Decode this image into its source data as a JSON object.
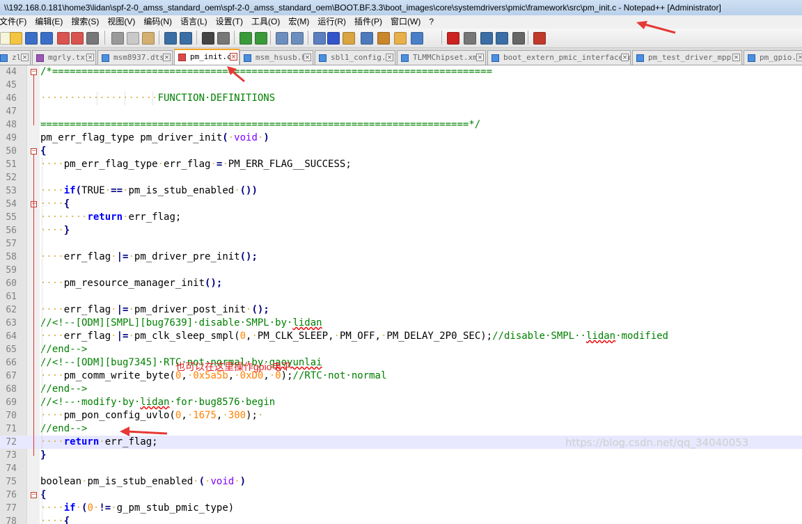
{
  "window": {
    "title": "\\\\192.168.0.181\\home3\\lidan\\spf-2-0_amss_standard_oem\\spf-2-0_amss_standard_oem\\BOOT.BF.3.3\\boot_images\\core\\systemdrivers\\pmic\\framework\\src\\pm_init.c - Notepad++ [Administrator]"
  },
  "menu": [
    "文件(F)",
    "编辑(E)",
    "搜索(S)",
    "视图(V)",
    "编码(N)",
    "语言(L)",
    "设置(T)",
    "工具(O)",
    "宏(M)",
    "运行(R)",
    "插件(P)",
    "窗口(W)",
    "?"
  ],
  "toolbar": {
    "icons": [
      "new-file-icon",
      "open-file-icon",
      "save-icon",
      "save-all-icon",
      "close-icon",
      "close-all-icon",
      "print-icon",
      "cut-icon",
      "copy-icon",
      "paste-icon",
      "undo-icon",
      "redo-icon",
      "find-icon",
      "replace-icon",
      "zoom-in-icon",
      "zoom-out-icon",
      "sync-vertical-icon",
      "sync-horizontal-icon",
      "word-wrap-icon",
      "show-all-chars-icon",
      "indent-guide-icon",
      "doc-map-icon",
      "function-list-icon",
      "folder-workspace-icon",
      "monitor-icon",
      "record-macro-icon",
      "stop-macro-icon",
      "play-macro-icon",
      "run-macro-multiple-icon",
      "save-macro-icon",
      "spell-check-icon"
    ]
  },
  "tabs": [
    {
      "label": "zly",
      "icon": "doc"
    },
    {
      "label": "mgrly.txt",
      "icon": "purple"
    },
    {
      "label": "msm8937.dtsi",
      "icon": "doc"
    },
    {
      "label": "pm_init.c",
      "icon": "save",
      "active": true
    },
    {
      "label": "msm_hsusb.h",
      "icon": "doc"
    },
    {
      "label": "sbl1_config.c",
      "icon": "doc"
    },
    {
      "label": "TLMMChipset.xml",
      "icon": "doc"
    },
    {
      "label": "boot_extern_pmic_interface.c",
      "icon": "doc"
    },
    {
      "label": "pm_test_driver_mpp.c",
      "icon": "doc"
    },
    {
      "label": "pm_gpio.c",
      "icon": "doc"
    }
  ],
  "editor": {
    "current_line": 72,
    "lines": [
      {
        "n": "44",
        "t": [
          [
            "cm",
            "/*==========================================================================="
          ]
        ]
      },
      {
        "n": "45",
        "t": []
      },
      {
        "n": "46",
        "t": [
          [
            "ws",
            "····················"
          ],
          [
            "cm",
            "FUNCTION·DEFINITIONS"
          ]
        ]
      },
      {
        "n": "47",
        "t": []
      },
      {
        "n": "48",
        "t": [
          [
            "cm",
            "=========================================================================*/"
          ]
        ]
      },
      {
        "n": "49",
        "t": [
          [
            "",
            "pm_err_flag_type pm_driver_init"
          ],
          [
            "op",
            "("
          ],
          [
            "ws",
            "·"
          ],
          [
            "ty",
            "void"
          ],
          [
            "ws",
            "·"
          ],
          [
            "op",
            ")"
          ]
        ]
      },
      {
        "n": "50",
        "t": [
          [
            "op",
            "{"
          ]
        ]
      },
      {
        "n": "51",
        "t": [
          [
            "ws",
            "····"
          ],
          [
            "",
            "pm_err_flag_type"
          ],
          [
            "ws",
            "·"
          ],
          [
            "",
            "err_flag"
          ],
          [
            "ws",
            "·"
          ],
          [
            "op",
            "="
          ],
          [
            "ws",
            "·"
          ],
          [
            "",
            "PM_ERR_FLAG__SUCCESS;"
          ]
        ]
      },
      {
        "n": "52",
        "t": []
      },
      {
        "n": "53",
        "t": [
          [
            "ws",
            "····"
          ],
          [
            "kw",
            "if"
          ],
          [
            "op",
            "("
          ],
          [
            "",
            "TRUE"
          ],
          [
            "ws",
            "·"
          ],
          [
            "op",
            "=="
          ],
          [
            "ws",
            "·"
          ],
          [
            "",
            "pm_is_stub_enabled"
          ],
          [
            "ws",
            "·"
          ],
          [
            "op",
            "())"
          ]
        ]
      },
      {
        "n": "54",
        "t": [
          [
            "ws",
            "····"
          ],
          [
            "op",
            "{"
          ]
        ]
      },
      {
        "n": "55",
        "t": [
          [
            "ws",
            "········"
          ],
          [
            "kw",
            "return"
          ],
          [
            "ws",
            "·"
          ],
          [
            "",
            "err_flag;"
          ]
        ]
      },
      {
        "n": "56",
        "t": [
          [
            "ws",
            "····"
          ],
          [
            "op",
            "}"
          ]
        ]
      },
      {
        "n": "57",
        "t": []
      },
      {
        "n": "58",
        "t": [
          [
            "ws",
            "····"
          ],
          [
            "",
            "err_flag"
          ],
          [
            "ws",
            "·"
          ],
          [
            "op",
            "|="
          ],
          [
            "ws",
            "·"
          ],
          [
            "",
            "pm_driver_pre_init"
          ],
          [
            "op",
            "();"
          ]
        ]
      },
      {
        "n": "59",
        "t": []
      },
      {
        "n": "60",
        "t": [
          [
            "ws",
            "····"
          ],
          [
            "",
            "pm_resource_manager_init"
          ],
          [
            "op",
            "();"
          ]
        ]
      },
      {
        "n": "61",
        "t": []
      },
      {
        "n": "62",
        "t": [
          [
            "ws",
            "····"
          ],
          [
            "",
            "err_flag"
          ],
          [
            "ws",
            "·"
          ],
          [
            "op",
            "|="
          ],
          [
            "ws",
            "·"
          ],
          [
            "",
            "pm_driver_post_init"
          ],
          [
            "ws",
            "·"
          ],
          [
            "op",
            "();"
          ]
        ]
      },
      {
        "n": "63",
        "t": [
          [
            "cm",
            "//<!--[ODM][SMPL][bug7639]·disable·SMPL·by·"
          ],
          [
            "cm sq",
            "lidan"
          ]
        ]
      },
      {
        "n": "64",
        "t": [
          [
            "ws",
            "····"
          ],
          [
            "",
            "err_flag"
          ],
          [
            "ws",
            "·"
          ],
          [
            "op",
            "|="
          ],
          [
            "ws",
            "·"
          ],
          [
            "",
            "pm_clk_sleep_smpl("
          ],
          [
            "num",
            "0"
          ],
          [
            "",
            ","
          ],
          [
            "ws",
            "·"
          ],
          [
            "",
            "PM_CLK_SLEEP,"
          ],
          [
            "ws",
            "·"
          ],
          [
            "",
            "PM_OFF,"
          ],
          [
            "ws",
            "·"
          ],
          [
            "",
            "PM_DELAY_2P0_SEC);"
          ],
          [
            "cm",
            "//disable·SMPL··"
          ],
          [
            "cm sq",
            "lidan"
          ],
          [
            "cm",
            "·modified"
          ]
        ]
      },
      {
        "n": "65",
        "t": [
          [
            "cm",
            "//end-->"
          ]
        ]
      },
      {
        "n": "66",
        "t": [
          [
            "cm",
            "//<!--[ODM][bug7345]·RTC·not·normal·by·"
          ],
          [
            "cm sq",
            "gaoyunlai"
          ]
        ]
      },
      {
        "n": "67",
        "t": [
          [
            "ws",
            "····"
          ],
          [
            "",
            "pm_comm_write_byte("
          ],
          [
            "num",
            "0"
          ],
          [
            "",
            ","
          ],
          [
            "ws",
            "·"
          ],
          [
            "num",
            "0x5a5b"
          ],
          [
            "",
            ","
          ],
          [
            "ws",
            "·"
          ],
          [
            "num",
            "0xD0"
          ],
          [
            "",
            ","
          ],
          [
            "ws",
            "·"
          ],
          [
            "num",
            "0"
          ],
          [
            "",
            ");"
          ],
          [
            "cm",
            "//RTC·not·normal"
          ]
        ]
      },
      {
        "n": "68",
        "t": [
          [
            "cm",
            "//end-->"
          ]
        ]
      },
      {
        "n": "69",
        "t": [
          [
            "cm",
            "//<!--·modify·by·"
          ],
          [
            "cm sq",
            "lidan"
          ],
          [
            "cm",
            "·for·bug8576·begin"
          ]
        ]
      },
      {
        "n": "70",
        "t": [
          [
            "ws",
            "····"
          ],
          [
            "",
            "pm_pon_config_uvlo("
          ],
          [
            "num",
            "0"
          ],
          [
            "",
            ","
          ],
          [
            "ws",
            "·"
          ],
          [
            "num",
            "1675"
          ],
          [
            "",
            ","
          ],
          [
            "ws",
            "·"
          ],
          [
            "num",
            "300"
          ],
          [
            "",
            ");"
          ],
          [
            "ws",
            "·"
          ]
        ]
      },
      {
        "n": "71",
        "t": [
          [
            "cm",
            "//end-->"
          ]
        ]
      },
      {
        "n": "72",
        "t": [
          [
            "ws",
            "····"
          ],
          [
            "kw",
            "return"
          ],
          [
            "ws",
            "·"
          ],
          [
            "",
            "err_flag;"
          ]
        ]
      },
      {
        "n": "73",
        "t": [
          [
            "op",
            "}"
          ]
        ]
      },
      {
        "n": "74",
        "t": []
      },
      {
        "n": "75",
        "t": [
          [
            "",
            "boolean"
          ],
          [
            "ws",
            "·"
          ],
          [
            "",
            "pm_is_stub_enabled"
          ],
          [
            "ws",
            "·"
          ],
          [
            "op",
            "("
          ],
          [
            "ws",
            "·"
          ],
          [
            "ty",
            "void"
          ],
          [
            "ws",
            "·"
          ],
          [
            "op",
            ")"
          ]
        ]
      },
      {
        "n": "76",
        "t": [
          [
            "op",
            "{"
          ]
        ]
      },
      {
        "n": "77",
        "t": [
          [
            "ws",
            "····"
          ],
          [
            "kw",
            "if"
          ],
          [
            "ws",
            "·"
          ],
          [
            "op",
            "("
          ],
          [
            "num",
            "0"
          ],
          [
            "ws",
            "·"
          ],
          [
            "op",
            "!="
          ],
          [
            "ws",
            "·"
          ],
          [
            "",
            "g_pm_stub_pmic_type)"
          ]
        ]
      },
      {
        "n": "78",
        "t": [
          [
            "ws",
            "····"
          ],
          [
            "op",
            "{"
          ]
        ]
      }
    ]
  },
  "annotation": {
    "text": "也可以在这里操作gpio电平",
    "color": "#e02020"
  },
  "watermark": "https://blog.csdn.net/qq_34040053",
  "colors": {
    "keyword": "#0000ff",
    "type": "#8000ff",
    "number": "#ff8000",
    "comment": "#008000",
    "current_line": "#e8e8ff",
    "annotation": "#e02020"
  }
}
